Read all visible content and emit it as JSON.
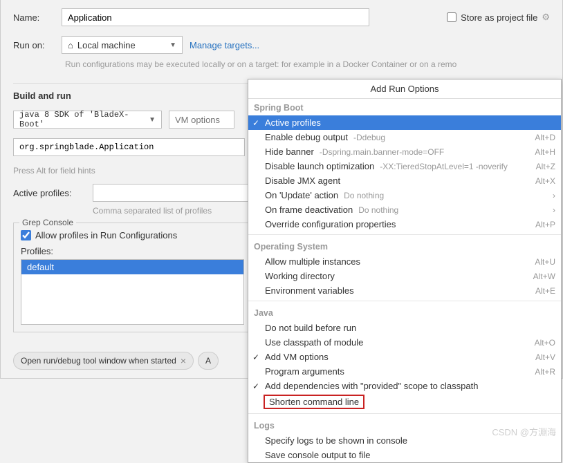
{
  "header": {
    "name_label": "Name:",
    "name_value": "Application",
    "store_checkbox_label": "Store as project file"
  },
  "run_on": {
    "label": "Run on:",
    "value": "Local machine",
    "manage_link": "Manage targets...",
    "hint": "Run configurations may be executed locally or on a target: for example in a Docker Container or on a remo"
  },
  "build_run": {
    "title": "Build and run",
    "sdk": "java 8 SDK of 'BladeX-Boot'",
    "vm_placeholder": "VM options",
    "main_class": "org.springblade.Application",
    "alt_hint": "Press Alt for field hints",
    "active_profiles_label": "Active profiles:",
    "comma_hint": "Comma separated list of profiles"
  },
  "grep": {
    "title": "Grep Console",
    "allow_label": "Allow profiles in Run Configurations",
    "profiles_label": "Profiles:",
    "default_item": "default"
  },
  "bottom": {
    "open_window": "Open run/debug tool window when started"
  },
  "popup": {
    "title": "Add Run Options",
    "sections": {
      "spring_boot": "Spring Boot",
      "operating_system": "Operating System",
      "java": "Java",
      "logs": "Logs"
    },
    "items": {
      "active_profiles": "Active profiles",
      "enable_debug": "Enable debug output",
      "enable_debug_desc": "-Ddebug",
      "enable_debug_sc": "Alt+D",
      "hide_banner": "Hide banner",
      "hide_banner_desc": "-Dspring.main.banner-mode=OFF",
      "hide_banner_sc": "Alt+H",
      "disable_launch": "Disable launch optimization",
      "disable_launch_desc": "-XX:TieredStopAtLevel=1 -noverify",
      "disable_launch_sc": "Alt+Z",
      "disable_jmx": "Disable JMX agent",
      "disable_jmx_sc": "Alt+X",
      "on_update": "On 'Update' action",
      "on_update_desc": "Do nothing",
      "on_frame": "On frame deactivation",
      "on_frame_desc": "Do nothing",
      "override_config": "Override configuration properties",
      "override_config_sc": "Alt+P",
      "allow_multiple": "Allow multiple instances",
      "allow_multiple_sc": "Alt+U",
      "working_dir": "Working directory",
      "working_dir_sc": "Alt+W",
      "env_vars": "Environment variables",
      "env_vars_sc": "Alt+E",
      "no_build": "Do not build before run",
      "use_classpath": "Use classpath of module",
      "use_classpath_sc": "Alt+O",
      "add_vm": "Add VM options",
      "add_vm_sc": "Alt+V",
      "program_args": "Program arguments",
      "program_args_sc": "Alt+R",
      "add_deps": "Add dependencies with \"provided\" scope to classpath",
      "shorten": "Shorten command line",
      "specify_logs": "Specify logs to be shown in console",
      "save_console": "Save console output to file"
    }
  },
  "watermark": "CSDN @方淵海"
}
